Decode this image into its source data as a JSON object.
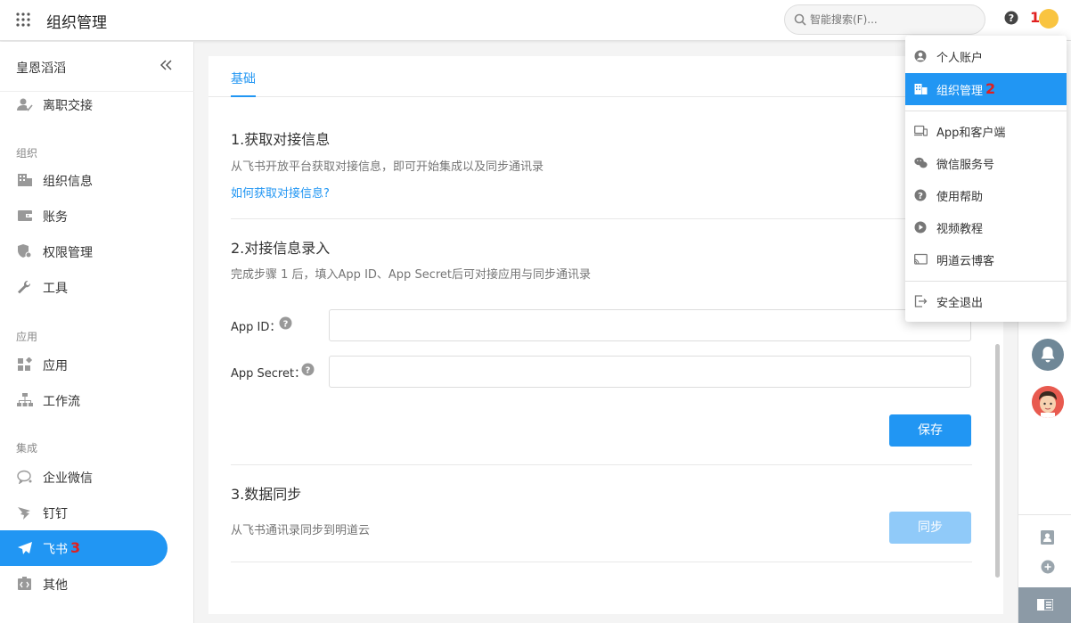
{
  "header": {
    "app_title": "组织管理",
    "search_placeholder": "智能搜索(F)...",
    "annotation_1": "1"
  },
  "sidebar": {
    "org_name": "皇恩滔滔",
    "top_item": {
      "label": "离职交接",
      "icon": "user-check-icon"
    },
    "sections": [
      {
        "label": "组织",
        "items": [
          {
            "label": "组织信息",
            "icon": "building-icon"
          },
          {
            "label": "账务",
            "icon": "wallet-icon"
          },
          {
            "label": "权限管理",
            "icon": "shield-lock-icon"
          },
          {
            "label": "工具",
            "icon": "wrench-icon"
          }
        ]
      },
      {
        "label": "应用",
        "items": [
          {
            "label": "应用",
            "icon": "apps-icon"
          },
          {
            "label": "工作流",
            "icon": "workflow-icon"
          }
        ]
      },
      {
        "label": "集成",
        "items": [
          {
            "label": "企业微信",
            "icon": "wecom-icon"
          },
          {
            "label": "钉钉",
            "icon": "dingtalk-icon"
          },
          {
            "label": "飞书",
            "icon": "feishu-icon",
            "active": true
          },
          {
            "label": "其他",
            "icon": "code-icon"
          }
        ]
      }
    ],
    "annotation_3": "3"
  },
  "content": {
    "tab": "基础",
    "section1": {
      "title": "1.获取对接信息",
      "desc": "从飞书开放平台获取对接信息，即可开始集成以及同步通讯录",
      "link": "如何获取对接信息?"
    },
    "section2": {
      "title": "2.对接信息录入",
      "desc": "完成步骤 1 后，填入App ID、App Secret后可对接应用与同步通讯录",
      "app_id_label": "App ID：",
      "app_id_value": "",
      "app_secret_label": "App Secret：",
      "app_secret_value": "",
      "save_button": "保存"
    },
    "section3": {
      "title": "3.数据同步",
      "desc": "从飞书通讯录同步到明道云",
      "sync_button": "同步"
    }
  },
  "dropdown": {
    "items": [
      {
        "label": "个人账户",
        "icon": "user-circle-icon"
      },
      {
        "label": "组织管理",
        "icon": "building-icon",
        "active": true
      },
      {
        "label": "App和客户端",
        "icon": "devices-icon"
      },
      {
        "label": "微信服务号",
        "icon": "wechat-icon"
      },
      {
        "label": "使用帮助",
        "icon": "help-circle-icon"
      },
      {
        "label": "视频教程",
        "icon": "play-circle-icon"
      },
      {
        "label": "明道云博客",
        "icon": "cast-icon"
      },
      {
        "label": "安全退出",
        "icon": "logout-icon"
      }
    ],
    "annotation_2": "2"
  },
  "colors": {
    "accent": "#2196f3",
    "disabled": "#90caf9",
    "annotation": "#e02020"
  }
}
